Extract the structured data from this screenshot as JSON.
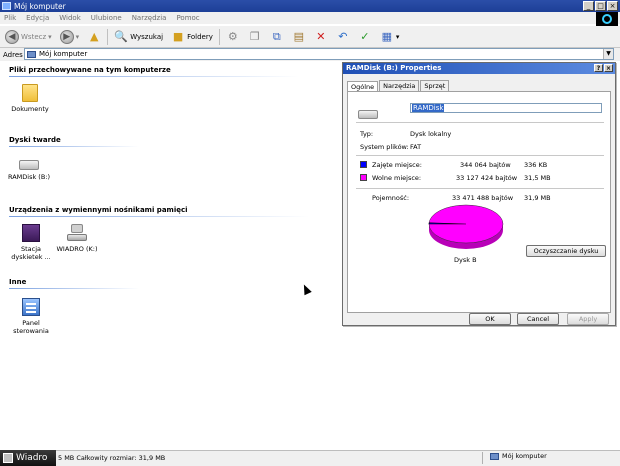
{
  "window": {
    "title": "Mój komputer"
  },
  "menu": [
    "Plik",
    "Edycja",
    "Widok",
    "Ulubione",
    "Narzędzia",
    "Pomoc"
  ],
  "toolbar": {
    "back": "Wstecz",
    "search": "Wyszukaj",
    "folders": "Foldery"
  },
  "address": {
    "label": "Adres",
    "value": "Mój komputer"
  },
  "sections": {
    "files": {
      "title": "Pliki przechowywane na tym komputerze",
      "items": [
        "Dokumenty"
      ]
    },
    "hdd": {
      "title": "Dyski twarde",
      "items": [
        "RAMDisk (B:)"
      ]
    },
    "removable": {
      "title": "Urządzenia z wymiennymi nośnikami pamięci",
      "items": [
        "Stacja dyskietek ...",
        "WIADRO (K:)"
      ]
    },
    "other": {
      "title": "Inne",
      "items": [
        "Panel sterowania"
      ]
    }
  },
  "dialog": {
    "title": "RAMDisk (B:) Properties",
    "tabs": [
      "Ogólne",
      "Narzędzia",
      "Sprzęt"
    ],
    "name_value": "RAMDisk",
    "type_label": "Typ:",
    "type_value": "Dysk lokalny",
    "fs_label": "System plików:",
    "fs_value": "FAT",
    "used_label": "Zajęte miejsce:",
    "used_bytes": "344 064 bajtów",
    "used_size": "336 KB",
    "free_label": "Wolne miejsce:",
    "free_bytes": "33 127 424 bajtów",
    "free_size": "31,5 MB",
    "capacity_label": "Pojemność:",
    "capacity_bytes": "33 471 488 bajtów",
    "capacity_size": "31,9 MB",
    "drive_label": "Dysk B",
    "cleanup_button": "Oczyszczanie dysku",
    "ok_button": "OK",
    "cancel_button": "Cancel",
    "apply_button": "Apply",
    "used_color": "#0000ff",
    "free_color": "#ff00ff",
    "used_fraction": 0.0103
  },
  "statusbar": {
    "taskbar_label": "Wiadro",
    "text": "5 MB Całkowity rozmiar: 31,9 MB",
    "location": "Mój komputer"
  }
}
